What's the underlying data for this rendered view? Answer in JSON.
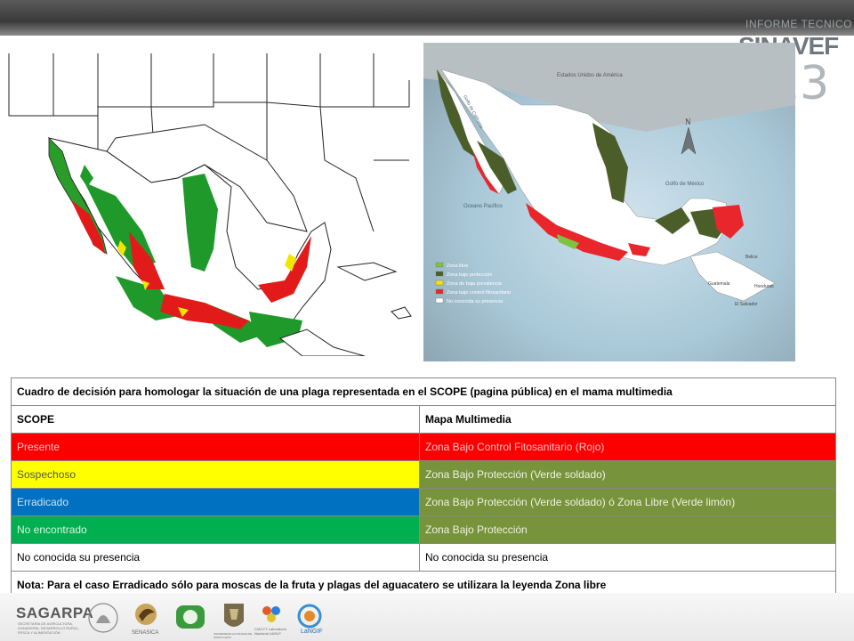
{
  "header": {
    "brand_line1": "INFORME TECNICO",
    "brand_line2": "SINAVEF",
    "brand_year": "13"
  },
  "map_right": {
    "label_usa": "Estados Unidos de América",
    "label_gulf_california": "Golfo de California",
    "label_gulf_mexico": "Golfo de México",
    "label_pacific": "Oceano Pacifico",
    "label_belize": "Belice",
    "label_guatemala": "Guatemala",
    "label_honduras": "Honduras",
    "label_el_salvador": "El Salvador",
    "compass_n": "N",
    "legend": [
      {
        "label": "Zona libre",
        "color": "#7ec242"
      },
      {
        "label": "Zona bajo protección",
        "color": "#4b5e2a"
      },
      {
        "label": "Zona de baja prevalencia",
        "color": "#f2e600"
      },
      {
        "label": "Zona bajo control fitosanitario",
        "color": "#e8262b"
      },
      {
        "label": "No conocida su presencia",
        "color": "#ffffff"
      }
    ]
  },
  "table": {
    "title": "Cuadro de decisión para homologar la situación de una plaga representada en el SCOPE (pagina pública) en el mama multimedia",
    "col1_header": "SCOPE",
    "col2_header": "Mapa Multimedia",
    "rows": [
      {
        "scope": "Presente",
        "multimedia": "Zona Bajo Control Fitosanitario (Rojo)"
      },
      {
        "scope": "Sospechoso",
        "multimedia": "Zona Bajo Protección (Verde soldado)"
      },
      {
        "scope": "Erradicado",
        "multimedia": "Zona Bajo Protección (Verde soldado) ó Zona Libre (Verde limón)"
      },
      {
        "scope": "No encontrado",
        "multimedia": "Zona Bajo Protección"
      },
      {
        "scope": "No conocida su presencia",
        "multimedia": "No conocida su presencia"
      }
    ],
    "note": "Nota: Para el caso Erradicado sólo para moscas de la fruta y plagas del aguacatero se utilizara la leyenda Zona libre"
  },
  "colors": {
    "red": "#fc0000",
    "yellow": "#ffff00",
    "blue": "#0070c0",
    "green": "#00b050",
    "olive": "#77933c"
  },
  "footer": {
    "sagarpa": "SAGARPA",
    "sagarpa_sub": "SECRETARÍA DE AGRICULTURA, GANADERÍA, DESARROLLO RURAL, PESCA Y ALIMENTACIÓN",
    "senasica": "SENASICA",
    "uanl": "UNIVERSIDAD AUTONOMA DE NUEVO LEON",
    "ciacyt": "CIACYT Laboratorio Nacional UASLP",
    "langif": "LaNGIF"
  }
}
